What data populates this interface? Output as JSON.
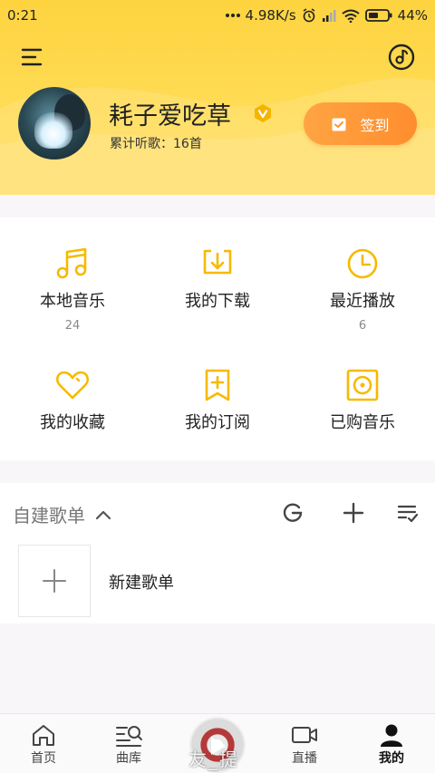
{
  "status_bar": {
    "time": "0:21",
    "speed": "4.98K/s",
    "battery": "44%",
    "icons": [
      "dots-icon",
      "alarm-icon",
      "signal-icon",
      "wifi-icon",
      "battery-icon"
    ]
  },
  "header": {
    "menu_icon": "menu-icon",
    "disc_icon": "music-disc-icon",
    "username": "耗子爱吃草",
    "vip_icon": "vip-badge-icon",
    "listen_stat": {
      "label": "累计听歌：",
      "value": "16首"
    },
    "checkin_label": "签到",
    "checkin_icon": "checkin-icon",
    "accent_color": "#fdd33f"
  },
  "features": [
    {
      "label": "本地音乐",
      "count": "24",
      "icon": "music-note-icon"
    },
    {
      "label": "我的下载",
      "count": "",
      "icon": "download-icon"
    },
    {
      "label": "最近播放",
      "count": "6",
      "icon": "clock-icon"
    },
    {
      "label": "我的收藏",
      "count": "",
      "icon": "heart-icon"
    },
    {
      "label": "我的订阅",
      "count": "",
      "icon": "bookmark-add-icon"
    },
    {
      "label": "已购音乐",
      "count": "",
      "icon": "purchased-disc-icon"
    }
  ],
  "playlists": {
    "title": "自建歌单",
    "toggle_icon": "chevron-up-icon",
    "actions": [
      "import-icon",
      "add-icon",
      "manage-list-icon"
    ],
    "new_playlist_label": "新建歌单"
  },
  "bottom_nav": {
    "items": [
      {
        "label": "首页",
        "icon": "home-icon"
      },
      {
        "label": "曲库",
        "icon": "library-search-icon"
      },
      {
        "label": "直播",
        "icon": "video-camera-icon"
      },
      {
        "label": "我的",
        "icon": "user-icon"
      }
    ],
    "active": "我的",
    "player_overlay": "友_提"
  }
}
